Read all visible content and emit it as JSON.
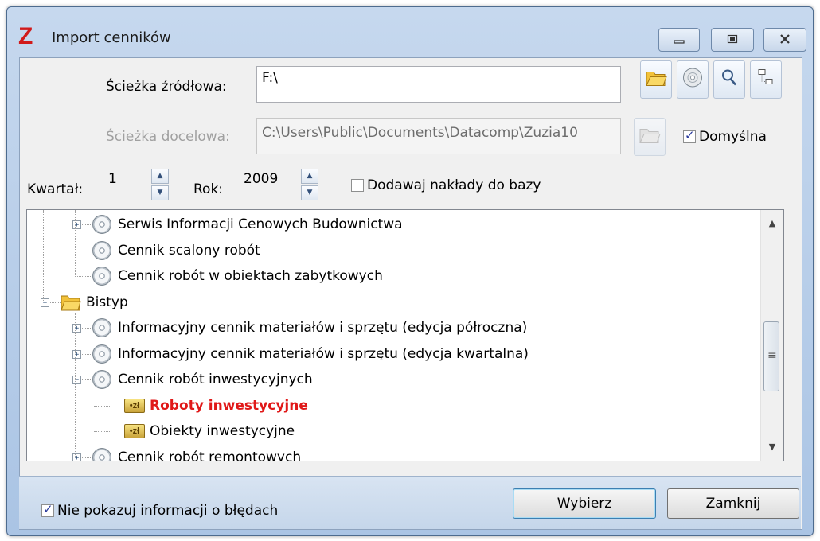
{
  "window": {
    "title": "Import cenników",
    "logo_glyph": "Z",
    "controls": [
      "minimize-icon",
      "restore-icon",
      "close-icon"
    ]
  },
  "source": {
    "label": "Ścieżka źródłowa:",
    "value": "F:\\"
  },
  "target": {
    "label": "Ścieżka docelowa:",
    "value": "C:\\Users\\Public\\Documents\\Datacomp\\Zuzia10",
    "default_label": "Domyślna",
    "default_checked": true
  },
  "quarter": {
    "label": "Kwartał:",
    "value": "1"
  },
  "year": {
    "label": "Rok:",
    "value": "2009"
  },
  "add_outlays": {
    "label": "Dodawaj nakłady do bazy",
    "checked": false
  },
  "tree": {
    "items": [
      {
        "label": "Serwis Informacji Cenowych Budownictwa",
        "icon": "disc-icon",
        "expander": "+",
        "level": 1
      },
      {
        "label": "Cennik scalony robót",
        "icon": "disc-icon",
        "expander": "",
        "level": 1
      },
      {
        "label": "Cennik robót w obiektach zabytkowych",
        "icon": "disc-icon",
        "expander": "",
        "level": 1
      },
      {
        "label": "Bistyp",
        "icon": "folder-icon",
        "expander": "−",
        "level": 0
      },
      {
        "label": "Informacyjny cennik materiałów i sprzętu (edycja półroczna)",
        "icon": "disc-icon",
        "expander": "+",
        "level": 1
      },
      {
        "label": "Informacyjny cennik materiałów i sprzętu (edycja kwartalna)",
        "icon": "disc-icon",
        "expander": "+",
        "level": 1
      },
      {
        "label": "Cennik robót inwestycyjnych",
        "icon": "disc-icon",
        "expander": "−",
        "level": 1
      },
      {
        "label": "Roboty inwestycyjne",
        "icon": "price-icon",
        "expander": "",
        "level": 2,
        "selected": true
      },
      {
        "label": "Obiekty inwestycyjne",
        "icon": "price-icon",
        "expander": "",
        "level": 2
      },
      {
        "label": "Cennik robót remontowych",
        "icon": "disc-icon",
        "expander": "+",
        "level": 1
      }
    ],
    "price_glyph": "•zł",
    "scroll_position": 0.45
  },
  "footer": {
    "no_errors_label": "Nie pokazuj informacji o błędach",
    "no_errors_checked": true,
    "choose_button": "Wybierz",
    "close_button": "Zamknij"
  },
  "colors": {
    "selected_item": "#e01818",
    "window_frame": "#b3cae6"
  }
}
